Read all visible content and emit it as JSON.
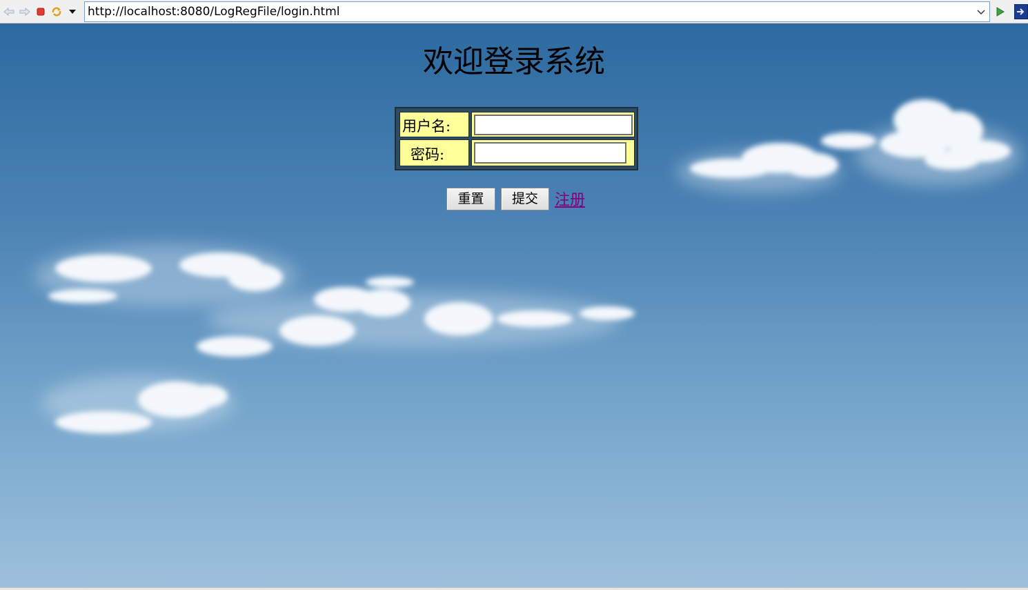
{
  "browser": {
    "url": "http://localhost:8080/LogRegFile/login.html",
    "icons": [
      "back-icon",
      "forward-icon",
      "stop-icon",
      "refresh-icon",
      "dropdown-icon",
      "go-icon",
      "extension-icon"
    ]
  },
  "page": {
    "title": "欢迎登录系统",
    "username_label": "用户名:",
    "password_label": "密码:",
    "username_value": "",
    "password_value": "",
    "reset_label": "重置",
    "submit_label": "提交",
    "register_label": "注册"
  },
  "colors": {
    "sky_top": "#2d6aa0",
    "sky_bottom": "#9dc0dc",
    "label_cell": "#ffff99",
    "link_visited": "#800080"
  }
}
